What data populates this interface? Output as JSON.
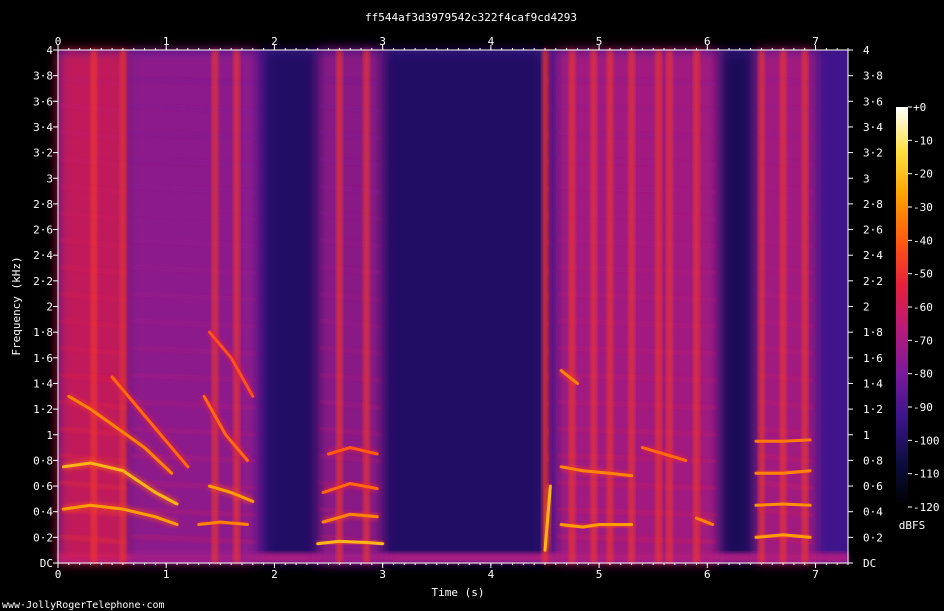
{
  "chart_data": {
    "type": "heatmap",
    "title": "ff544af3d3979542c322f4caf9cd4293",
    "xlabel": "Time (s)",
    "ylabel": "Frequency (kHz)",
    "x_ticks": [
      "0",
      "1",
      "2",
      "3",
      "4",
      "5",
      "6",
      "7"
    ],
    "y_ticks": [
      "DC",
      "0·2",
      "0·4",
      "0·6",
      "0·8",
      "1",
      "1·2",
      "1·4",
      "1·6",
      "1·8",
      "2",
      "2·2",
      "2·4",
      "2·6",
      "2·8",
      "3",
      "3·2",
      "3·4",
      "3·6",
      "3·8",
      "4"
    ],
    "xlim": [
      0,
      7.3
    ],
    "ylim": [
      0,
      4
    ],
    "colorbar": {
      "label": "dBFS",
      "ticks": [
        "+0",
        "-10",
        "-20",
        "-30",
        "-40",
        "-50",
        "-60",
        "-70",
        "-80",
        "-90",
        "-100",
        "-110",
        "-120"
      ],
      "range": [
        -120,
        0
      ],
      "stops": [
        "#000000",
        "#0d0d40",
        "#3a148a",
        "#7a1a9c",
        "#b81a7a",
        "#e8203c",
        "#ff5a10",
        "#ffa000",
        "#ffe040",
        "#ffffff"
      ]
    },
    "voiced_segments": [
      {
        "start": 0.0,
        "end": 0.65,
        "level_db": -30
      },
      {
        "start": 0.65,
        "end": 1.85,
        "level_db": -45
      },
      {
        "start": 2.4,
        "end": 3.0,
        "level_db": -45
      },
      {
        "start": 4.5,
        "end": 4.55,
        "level_db": -30
      },
      {
        "start": 4.6,
        "end": 6.1,
        "level_db": -40
      },
      {
        "start": 6.45,
        "end": 7.0,
        "level_db": -40
      }
    ],
    "formant_tracks": [
      {
        "points": [
          [
            0.05,
            0.75
          ],
          [
            0.3,
            0.78
          ],
          [
            0.6,
            0.72
          ],
          [
            0.9,
            0.55
          ],
          [
            1.1,
            0.46
          ]
        ],
        "level_db": -30
      },
      {
        "points": [
          [
            0.05,
            0.42
          ],
          [
            0.3,
            0.45
          ],
          [
            0.6,
            0.42
          ],
          [
            0.9,
            0.36
          ],
          [
            1.1,
            0.3
          ]
        ],
        "level_db": -35
      },
      {
        "points": [
          [
            0.1,
            1.3
          ],
          [
            0.3,
            1.2
          ],
          [
            0.55,
            1.05
          ],
          [
            0.8,
            0.9
          ],
          [
            1.05,
            0.7
          ]
        ],
        "level_db": -40
      },
      {
        "points": [
          [
            0.5,
            1.45
          ],
          [
            0.75,
            1.2
          ],
          [
            1.0,
            0.95
          ],
          [
            1.2,
            0.75
          ]
        ],
        "level_db": -45
      },
      {
        "points": [
          [
            1.3,
            0.3
          ],
          [
            1.5,
            0.32
          ],
          [
            1.75,
            0.3
          ]
        ],
        "level_db": -40
      },
      {
        "points": [
          [
            1.4,
            0.6
          ],
          [
            1.6,
            0.55
          ],
          [
            1.8,
            0.48
          ]
        ],
        "level_db": -35
      },
      {
        "points": [
          [
            1.35,
            1.3
          ],
          [
            1.55,
            1.0
          ],
          [
            1.75,
            0.8
          ]
        ],
        "level_db": -45
      },
      {
        "points": [
          [
            1.4,
            1.8
          ],
          [
            1.6,
            1.6
          ],
          [
            1.8,
            1.3
          ]
        ],
        "level_db": -50
      },
      {
        "points": [
          [
            2.4,
            0.15
          ],
          [
            2.6,
            0.17
          ],
          [
            2.85,
            0.16
          ],
          [
            3.0,
            0.15
          ]
        ],
        "level_db": -30
      },
      {
        "points": [
          [
            2.45,
            0.32
          ],
          [
            2.7,
            0.38
          ],
          [
            2.95,
            0.36
          ]
        ],
        "level_db": -40
      },
      {
        "points": [
          [
            2.45,
            0.55
          ],
          [
            2.7,
            0.62
          ],
          [
            2.95,
            0.58
          ]
        ],
        "level_db": -45
      },
      {
        "points": [
          [
            2.5,
            0.85
          ],
          [
            2.7,
            0.9
          ],
          [
            2.95,
            0.85
          ]
        ],
        "level_db": -48
      },
      {
        "points": [
          [
            4.5,
            0.1
          ],
          [
            4.53,
            0.4
          ],
          [
            4.55,
            0.6
          ]
        ],
        "level_db": -30
      },
      {
        "points": [
          [
            4.65,
            0.3
          ],
          [
            4.85,
            0.28
          ],
          [
            5.0,
            0.3
          ],
          [
            5.3,
            0.3
          ]
        ],
        "level_db": -35
      },
      {
        "points": [
          [
            4.65,
            0.75
          ],
          [
            4.85,
            0.72
          ],
          [
            5.1,
            0.7
          ],
          [
            5.3,
            0.68
          ]
        ],
        "level_db": -40
      },
      {
        "points": [
          [
            4.65,
            1.5
          ],
          [
            4.8,
            1.4
          ]
        ],
        "level_db": -40
      },
      {
        "points": [
          [
            5.4,
            0.9
          ],
          [
            5.6,
            0.85
          ],
          [
            5.8,
            0.8
          ]
        ],
        "level_db": -45
      },
      {
        "points": [
          [
            5.9,
            0.35
          ],
          [
            6.05,
            0.3
          ]
        ],
        "level_db": -40
      },
      {
        "points": [
          [
            6.45,
            0.2
          ],
          [
            6.7,
            0.22
          ],
          [
            6.95,
            0.2
          ]
        ],
        "level_db": -35
      },
      {
        "points": [
          [
            6.45,
            0.45
          ],
          [
            6.7,
            0.46
          ],
          [
            6.95,
            0.45
          ]
        ],
        "level_db": -38
      },
      {
        "points": [
          [
            6.45,
            0.7
          ],
          [
            6.7,
            0.7
          ],
          [
            6.95,
            0.72
          ]
        ],
        "level_db": -40
      },
      {
        "points": [
          [
            6.45,
            0.95
          ],
          [
            6.7,
            0.95
          ],
          [
            6.95,
            0.96
          ]
        ],
        "level_db": -42
      }
    ]
  },
  "footer": {
    "credit": "www·JollyRogerTelephone·com"
  }
}
